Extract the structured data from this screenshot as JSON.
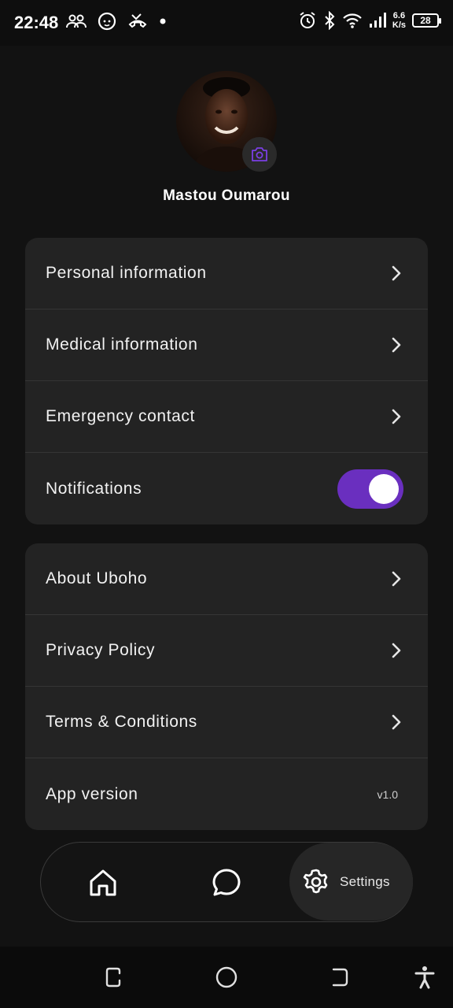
{
  "status_bar": {
    "time": "22:48",
    "net_speed_value": "6.6",
    "net_speed_unit": "K/s",
    "battery": "28",
    "icons": [
      "group-icon",
      "baby-icon",
      "missed-call-icon",
      "dot-icon",
      "alarm-icon",
      "bluetooth-icon",
      "wifi-icon",
      "signal-icon",
      "battery-icon"
    ]
  },
  "profile": {
    "name": "Mastou Oumarou",
    "camera_icon": "camera-icon"
  },
  "settings_group_1": {
    "items": [
      {
        "label": "Personal information",
        "icon": "chevron-right-icon"
      },
      {
        "label": "Medical information",
        "icon": "chevron-right-icon"
      },
      {
        "label": "Emergency contact",
        "icon": "chevron-right-icon"
      },
      {
        "label": "Notifications",
        "toggle_on": true
      }
    ]
  },
  "settings_group_2": {
    "items": [
      {
        "label": "About Uboho",
        "icon": "chevron-right-icon"
      },
      {
        "label": "Privacy Policy",
        "icon": "chevron-right-icon"
      },
      {
        "label": "Terms & Conditions",
        "icon": "chevron-right-icon"
      },
      {
        "label": "App version",
        "value": "v1.0"
      }
    ]
  },
  "bottom_nav": {
    "home_icon": "home-icon",
    "chat_icon": "chat-icon",
    "settings_icon": "gear-icon",
    "settings_label": "Settings"
  },
  "colors": {
    "accent": "#6a2fbf",
    "background": "#121212",
    "card": "#232323"
  }
}
